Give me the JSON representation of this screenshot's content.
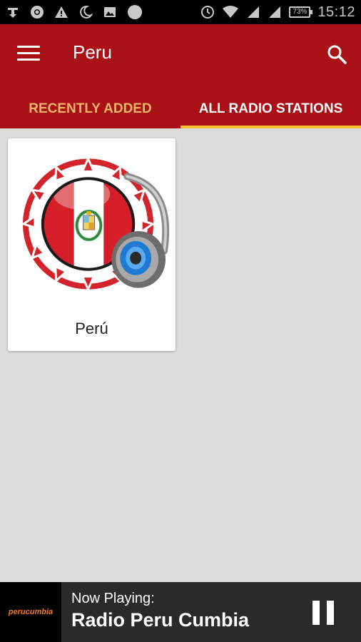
{
  "status_bar": {
    "time": "15:12",
    "battery_text": "73%",
    "icons": [
      "download-icon",
      "chrome-icon",
      "warning-icon",
      "moon-icon",
      "image-icon",
      "circle-icon",
      "sync-icon",
      "wifi-icon",
      "signal-icon",
      "signal-icon",
      "battery-icon"
    ]
  },
  "app_bar": {
    "title": "Peru",
    "menu_icon": "menu-icon",
    "search_icon": "search-icon",
    "color": "#aa1117"
  },
  "tabs": [
    {
      "label": "RECENTLY ADDED",
      "selected": false
    },
    {
      "label": "ALL RADIO STATIONS",
      "selected": true
    }
  ],
  "stations": [
    {
      "name": "Perú",
      "logo": "peru-flag-headphones-logo"
    }
  ],
  "player": {
    "label": "Now Playing:",
    "station": "Radio Peru Cumbia",
    "thumb": "perucumbia",
    "control_icon": "pause-icon"
  }
}
